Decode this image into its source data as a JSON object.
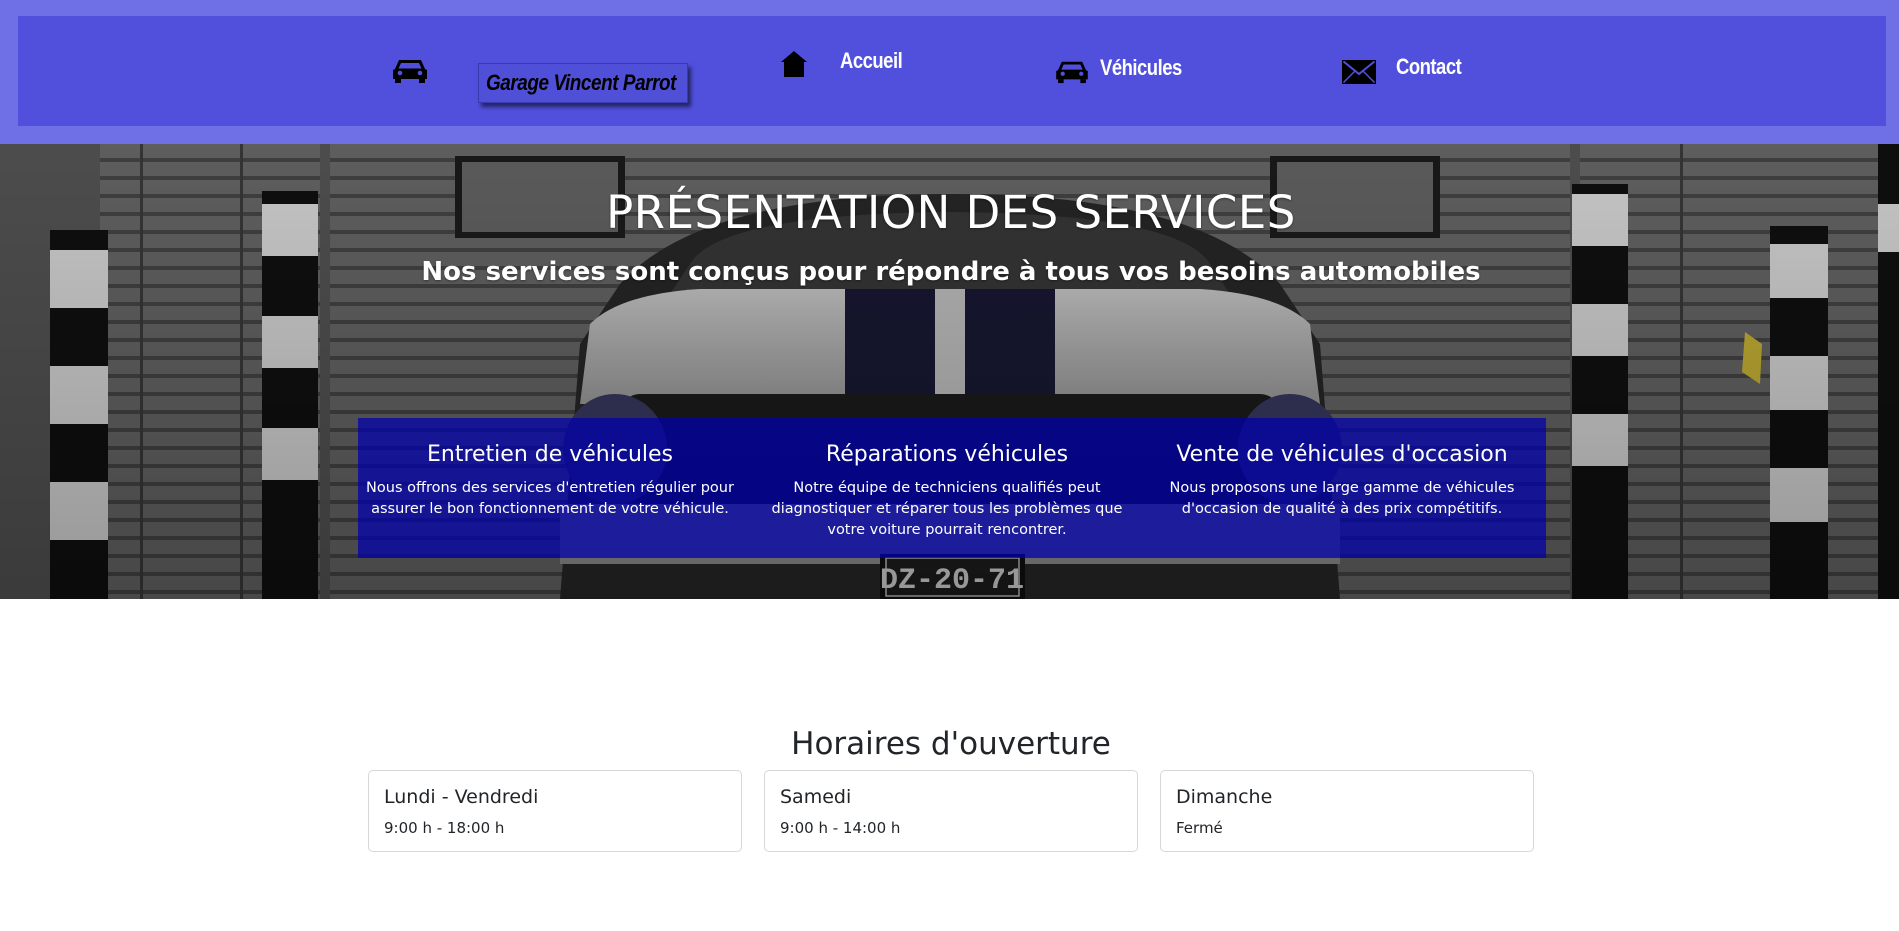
{
  "header": {
    "brand_icon": "car-icon",
    "brand": "Garage Vincent Parrot",
    "nav": [
      {
        "icon": "home-icon",
        "label": "Accueil"
      },
      {
        "icon": "car-icon",
        "label": "Véhicules"
      },
      {
        "icon": "envelope-icon",
        "label": "Contact"
      }
    ]
  },
  "hero": {
    "title": "PRÉSENTATION DES SERVICES",
    "subtitle": "Nos services sont conçus pour répondre à tous vos besoins automobiles",
    "background": "classic-car-photo",
    "services": [
      {
        "title": "Entretien de véhicules",
        "text": "Nous offrons des services d'entretien régulier pour assurer le bon fonctionnement de votre véhicule."
      },
      {
        "title": "Réparations véhicules",
        "text": "Notre équipe de techniciens qualifiés peut diagnostiquer et réparer tous les problèmes que votre voiture pourrait rencontrer."
      },
      {
        "title": "Vente de véhicules d'occasion",
        "text": "Nous proposons une large gamme de véhicules d'occasion de qualité à des prix compétitifs."
      }
    ]
  },
  "hours": {
    "title": "Horaires d'ouverture",
    "days": [
      {
        "day": "Lundi - Vendredi",
        "time": "9:00 h - 18:00 h"
      },
      {
        "day": "Samedi",
        "time": "9:00 h - 14:00 h"
      },
      {
        "day": "Dimanche",
        "time": "Fermé"
      }
    ]
  },
  "colors": {
    "header_outer": "#7070e6",
    "header_inner": "#5050dd",
    "services_panel": "#0000af",
    "text_light": "#ffffff"
  }
}
